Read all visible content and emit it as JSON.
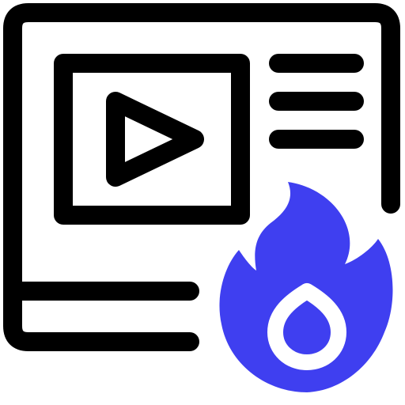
{
  "icon": {
    "name": "trending-video-icon",
    "parts": {
      "frame": "content-frame-icon",
      "video": "video-player-icon",
      "play": "play-icon",
      "text_lines": "text-lines-icon",
      "fire": "fire-icon",
      "drop": "drop-icon"
    }
  },
  "colors": {
    "stroke": "#000000",
    "accent": "#3f3ff0",
    "background": "#ffffff"
  }
}
